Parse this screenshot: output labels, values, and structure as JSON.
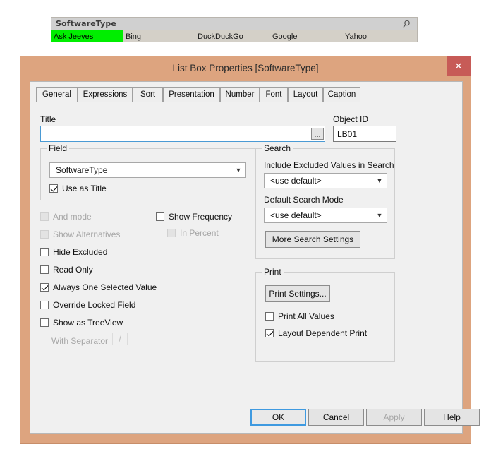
{
  "listbox_object": {
    "title": "SoftwareType",
    "search_icon": "magnifier-icon",
    "values": [
      {
        "label": "Ask Jeeves",
        "selected": true
      },
      {
        "label": "Bing",
        "selected": false
      },
      {
        "label": "DuckDuckGo",
        "selected": false
      },
      {
        "label": "Google",
        "selected": false
      },
      {
        "label": "Yahoo",
        "selected": false
      }
    ],
    "selection_color": "#00ee00",
    "caption_bg": "#d0d0d0",
    "body_bg": "#d4d0c8"
  },
  "dialog": {
    "title": "List Box Properties [SoftwareType]",
    "close_label": "✕",
    "border_color": "#dda47f",
    "close_color": "#c75b57",
    "tabs": [
      {
        "label": "General",
        "active": true
      },
      {
        "label": "Expressions",
        "active": false
      },
      {
        "label": "Sort",
        "active": false
      },
      {
        "label": "Presentation",
        "active": false
      },
      {
        "label": "Number",
        "active": false
      },
      {
        "label": "Font",
        "active": false
      },
      {
        "label": "Layout",
        "active": false
      },
      {
        "label": "Caption",
        "active": false
      }
    ],
    "general": {
      "title_label": "Title",
      "title_value": "",
      "title_placeholder": "",
      "ellipsis_label": "...",
      "object_id_label": "Object ID",
      "object_id_value": "LB01",
      "field_group_label": "Field",
      "field_value": "SoftwareType",
      "use_as_title": {
        "label": "Use as Title",
        "checked": true,
        "disabled": false
      },
      "options": [
        {
          "label": "And mode",
          "checked": false,
          "disabled": true
        },
        {
          "label": "Show Alternatives",
          "checked": false,
          "disabled": true
        },
        {
          "label": "Hide Excluded",
          "checked": false,
          "disabled": false
        },
        {
          "label": "Read Only",
          "checked": false,
          "disabled": false
        },
        {
          "label": "Always One Selected Value",
          "checked": true,
          "disabled": false
        },
        {
          "label": "Override Locked Field",
          "checked": false,
          "disabled": false
        },
        {
          "label": "Show as TreeView",
          "checked": false,
          "disabled": false
        }
      ],
      "with_separator_label": "With Separator",
      "with_separator_value": "/",
      "show_frequency": {
        "label": "Show Frequency",
        "checked": false,
        "disabled": false
      },
      "in_percent": {
        "label": "In Percent",
        "checked": false,
        "disabled": true
      },
      "search_group_label": "Search",
      "include_excluded_label": "Include Excluded Values in Search",
      "include_excluded_value": "<use default>",
      "default_search_mode_label": "Default Search Mode",
      "default_search_mode_value": "<use default>",
      "more_search_settings_label": "More Search Settings",
      "print_group_label": "Print",
      "print_settings_label": "Print Settings...",
      "print_all_values": {
        "label": "Print All Values",
        "checked": false,
        "disabled": false
      },
      "layout_dependent_print": {
        "label": "Layout Dependent Print",
        "checked": true,
        "disabled": false
      }
    },
    "buttons": [
      {
        "label": "OK",
        "style": "default",
        "disabled": false
      },
      {
        "label": "Cancel",
        "style": "normal",
        "disabled": false
      },
      {
        "label": "Apply",
        "style": "normal",
        "disabled": true
      },
      {
        "label": "Help",
        "style": "normal",
        "disabled": false
      }
    ]
  }
}
